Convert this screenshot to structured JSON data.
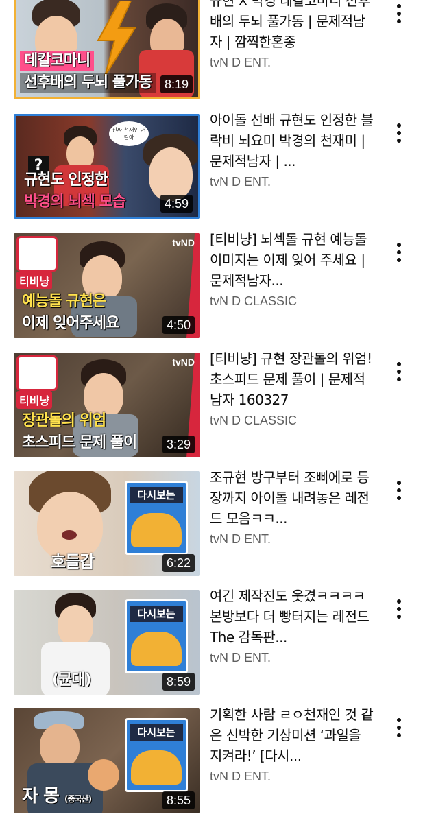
{
  "videos": [
    {
      "title": "규현 X 박경 데칼코마니 선후배의 두뇌 풀가동 | 문제적남자 | 깜찍한혼종",
      "channel": "tvN D ENT.",
      "duration": "8:19",
      "thumb_caption_top": "데칼코마니",
      "thumb_caption_bottom": "선후배의 두뇌 풀가동",
      "icon": "lightning-bolt"
    },
    {
      "title": "아이돌 선배 규현도 인정한 블락비 뇌요미 박경의 천재미 | 문제적남자 | ...",
      "channel": "tvN D ENT.",
      "duration": "4:59",
      "thumb_caption_top": "규현도 인정한",
      "thumb_caption_bottom": "박경의 뇌섹 모습",
      "thumb_bubble": "진짜 천재인 거 같아"
    },
    {
      "title": "[티비냥] 뇌섹돌 규현 예능돌 이미지는 이제 잊어 주세요 | 문제적남자...",
      "channel": "tvN D CLASSIC",
      "duration": "4:50",
      "thumb_caption_top": "예능돌 규현은",
      "thumb_caption_bottom": "이제 잊어주세요",
      "thumb_badge": "티비냥",
      "thumb_logo": "tvND"
    },
    {
      "title": "[티비냥] 규현 장관돌의 위엄! 초스피드 문제 풀이 | 문제적남자 160327",
      "channel": "tvN D CLASSIC",
      "duration": "3:29",
      "thumb_caption_top": "장관돌의 위엄",
      "thumb_caption_bottom": "초스피드 문제 풀이",
      "thumb_badge": "티비냥",
      "thumb_logo": "tvND"
    },
    {
      "title": "조규현 방구부터 조삐에로 등장까지 아이돌 내려놓은 레전드 모음ㅋㅋ...",
      "channel": "tvN D ENT.",
      "duration": "6:22",
      "thumb_caption_bottom": "호들갑",
      "thumb_promo": "다시보는"
    },
    {
      "title": "여긴 제작진도 웃겼ㅋㅋㅋㅋ본방보다 더 빵터지는 레전드 The 감독판...",
      "channel": "tvN D ENT.",
      "duration": "8:59",
      "thumb_caption_bottom": "(균대)",
      "thumb_promo": "다시보는"
    },
    {
      "title": "기획한 사람 ㄹㅇ천재인 것 같은 신박한 기상미션 ‘과일을 지켜라!’ [다시...",
      "channel": "tvN D ENT.",
      "duration": "8:55",
      "thumb_caption_bottom": "자 몽",
      "thumb_caption_small": "(중국산)",
      "thumb_promo": "다시보는"
    }
  ],
  "colors": {
    "title": "#0f0f0f",
    "channel": "#606060",
    "duration_bg": "#000000",
    "caption_pink": "#ff4f8b",
    "caption_yellow": "#ffe14d"
  }
}
